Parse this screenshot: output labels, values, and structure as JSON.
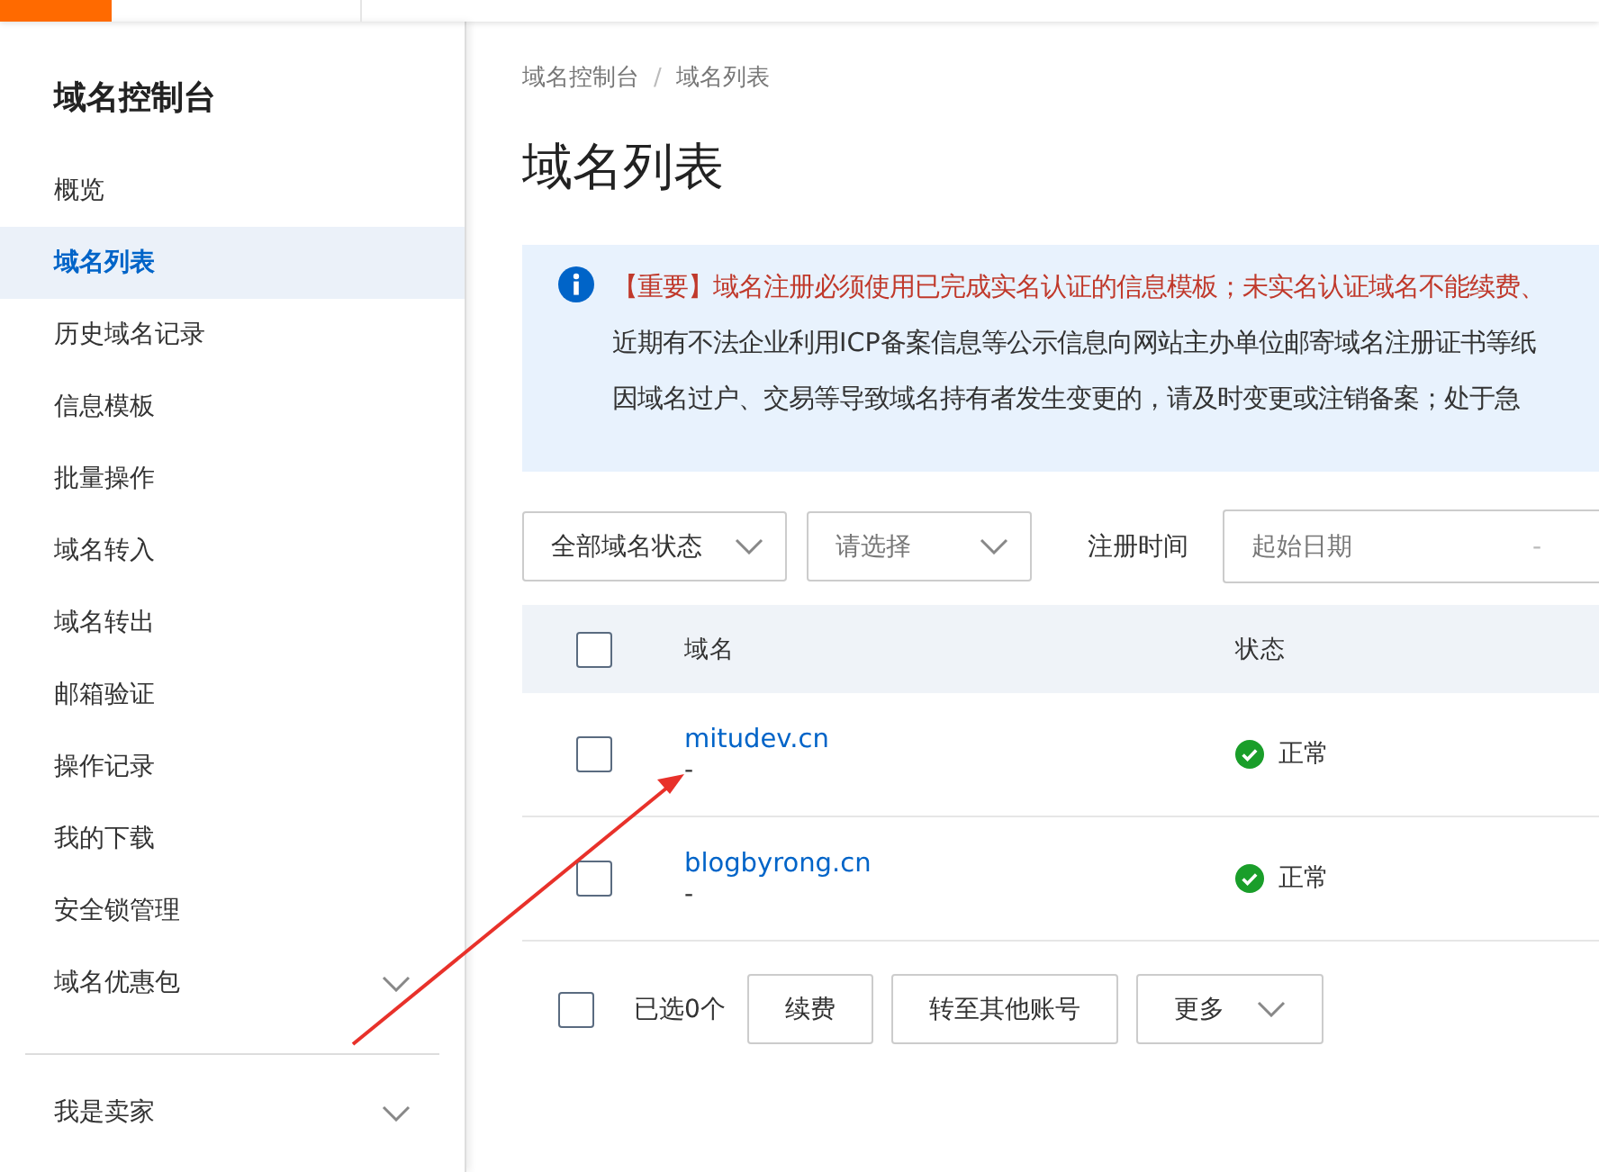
{
  "sidebar": {
    "title": "域名控制台",
    "items": [
      {
        "label": "概览",
        "selected": false,
        "expandable": false
      },
      {
        "label": "域名列表",
        "selected": true,
        "expandable": false
      },
      {
        "label": "历史域名记录",
        "selected": false,
        "expandable": false
      },
      {
        "label": "信息模板",
        "selected": false,
        "expandable": false
      },
      {
        "label": "批量操作",
        "selected": false,
        "expandable": false
      },
      {
        "label": "域名转入",
        "selected": false,
        "expandable": false
      },
      {
        "label": "域名转出",
        "selected": false,
        "expandable": false
      },
      {
        "label": "邮箱验证",
        "selected": false,
        "expandable": false
      },
      {
        "label": "操作记录",
        "selected": false,
        "expandable": false
      },
      {
        "label": "我的下载",
        "selected": false,
        "expandable": false
      },
      {
        "label": "安全锁管理",
        "selected": false,
        "expandable": false
      },
      {
        "label": "域名优惠包",
        "selected": false,
        "expandable": true
      }
    ],
    "footer_item": {
      "label": "我是卖家",
      "expandable": true
    }
  },
  "breadcrumb": [
    "域名控制台",
    "域名列表"
  ],
  "breadcrumb_separator": "/",
  "page_title": "域名列表",
  "notice": {
    "lines": [
      {
        "kind": "important",
        "text": "【重要】域名注册必须使用已完成实名认证的信息模板；未实名认证域名不能续费、"
      },
      {
        "kind": "plain",
        "text": "近期有不法企业利用ICP备案信息等公示信息向网站主办单位邮寄域名注册证书等纸"
      },
      {
        "kind": "plain",
        "text": "因域名过户、交易等导致域名持有者发生变更的，请及时变更或注销备案；处于急"
      }
    ]
  },
  "filters": {
    "status_select": {
      "value": "全部域名状态"
    },
    "second_select": {
      "placeholder": "请选择"
    },
    "date_label": "注册时间",
    "date_range": {
      "start_placeholder": "起始日期",
      "separator": "-"
    }
  },
  "table": {
    "all_checked": false,
    "columns": [
      "域名",
      "状态"
    ],
    "rows": [
      {
        "checked": false,
        "domain": "mitudev.cn",
        "note": "-",
        "status": "正常"
      },
      {
        "checked": false,
        "domain": "blogbyrong.cn",
        "note": "-",
        "status": "正常"
      }
    ]
  },
  "bulk_bar": {
    "checked": false,
    "selected_count": "已选0个",
    "buttons": [
      "续费",
      "转至其他账号"
    ],
    "more": "更多"
  }
}
